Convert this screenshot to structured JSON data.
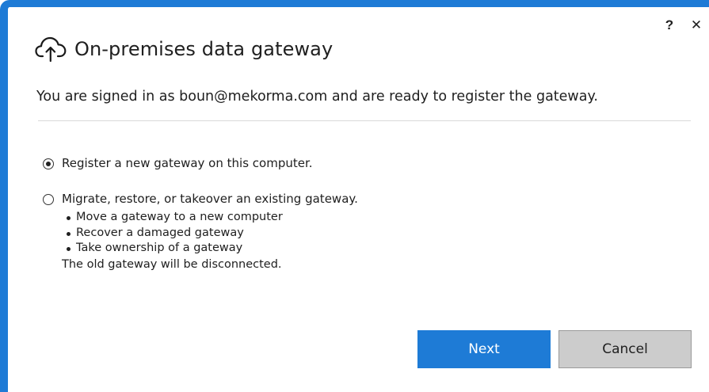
{
  "window": {
    "help_label": "?",
    "close_label": "✕"
  },
  "header": {
    "title": "On-premises data gateway",
    "icon": "cloud-upload-icon",
    "subtitle": "You are signed in as boun@mekorma.com and are ready to register the gateway."
  },
  "options": {
    "register_new": {
      "label": "Register a new gateway on this computer.",
      "selected": true
    },
    "migrate": {
      "label": "Migrate, restore, or takeover an existing gateway.",
      "selected": false,
      "bullets": [
        "Move a gateway to a new computer",
        "Recover a damaged gateway",
        "Take ownership of a gateway"
      ],
      "note": "The old gateway will be disconnected."
    }
  },
  "buttons": {
    "next_label": "Next",
    "cancel_label": "Cancel"
  },
  "colors": {
    "accent": "#1e7bd6",
    "cancel_bg": "#cccccc"
  }
}
